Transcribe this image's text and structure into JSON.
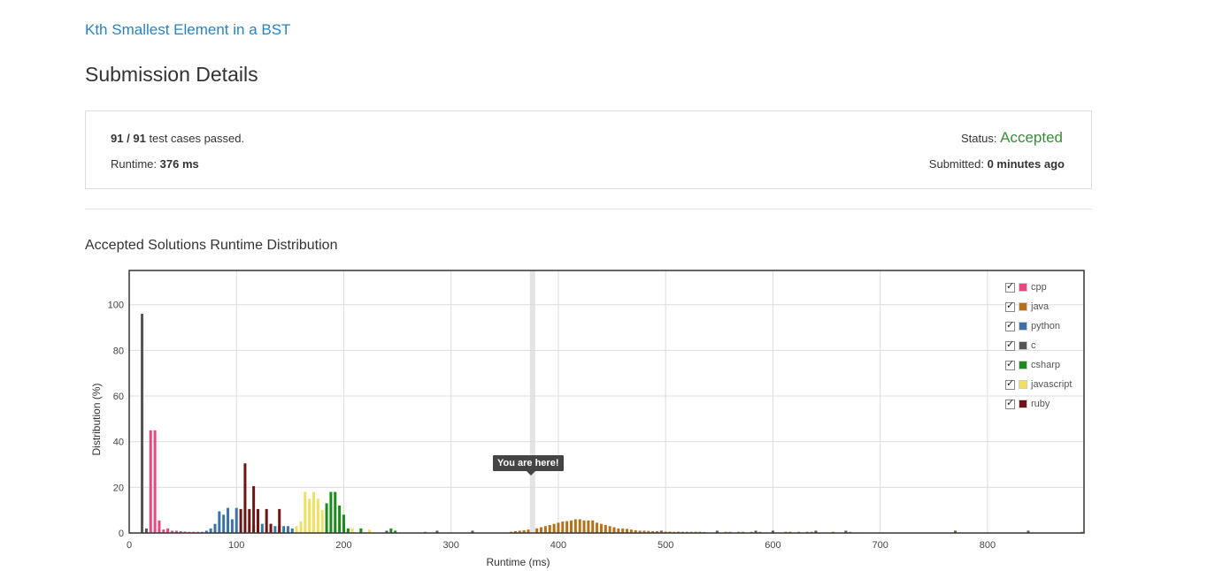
{
  "problem_link": "Kth Smallest Element in a BST",
  "page_title": "Submission Details",
  "details": {
    "passed": "91",
    "slash": "/",
    "total": "91",
    "passed_suffix": "test cases passed.",
    "runtime_label": "Runtime:",
    "runtime_value": "376 ms",
    "status_label": "Status:",
    "status_value": "Accepted",
    "submitted_label": "Submitted:",
    "submitted_value": "0 minutes ago"
  },
  "distribution_title": "Accepted Solutions Runtime Distribution",
  "tooltip": "You are here!",
  "legend": [
    {
      "name": "cpp",
      "color": "#e8487e"
    },
    {
      "name": "java",
      "color": "#b3711a"
    },
    {
      "name": "python",
      "color": "#3b73a6"
    },
    {
      "name": "c",
      "color": "#555555"
    },
    {
      "name": "csharp",
      "color": "#1a8a1a"
    },
    {
      "name": "javascript",
      "color": "#f0e060"
    },
    {
      "name": "ruby",
      "color": "#6e1414"
    }
  ],
  "chart_data": {
    "type": "bar",
    "xlabel": "Runtime (ms)",
    "ylabel": "Distribution (%)",
    "xlim": [
      0,
      890
    ],
    "ylim": [
      0,
      115
    ],
    "xticks": [
      0,
      100,
      200,
      300,
      400,
      500,
      600,
      700,
      800
    ],
    "yticks": [
      0,
      20,
      40,
      60,
      80,
      100
    ],
    "marker_x": 376,
    "series": [
      {
        "name": "c",
        "points": [
          [
            12,
            96
          ],
          [
            16,
            2
          ],
          [
            140,
            3
          ],
          [
            240,
            1
          ],
          [
            287,
            1
          ],
          [
            320,
            1
          ],
          [
            496,
            1
          ],
          [
            548,
            1
          ],
          [
            584,
            1
          ],
          [
            600,
            1
          ],
          [
            640,
            1
          ],
          [
            668,
            1
          ],
          [
            770,
            1
          ],
          [
            838,
            1
          ]
        ]
      },
      {
        "name": "cpp",
        "points": [
          [
            20,
            45
          ],
          [
            24,
            45
          ],
          [
            28,
            5.5
          ],
          [
            32,
            1.5
          ],
          [
            36,
            2
          ],
          [
            40,
            1
          ],
          [
            44,
            1
          ],
          [
            48,
            0.8
          ],
          [
            52,
            0.6
          ],
          [
            56,
            0.5
          ],
          [
            60,
            0.5
          ],
          [
            64,
            0.5
          ],
          [
            68,
            0.5
          ],
          [
            276,
            0.5
          ]
        ]
      },
      {
        "name": "python",
        "points": [
          [
            72,
            1
          ],
          [
            76,
            2
          ],
          [
            80,
            4
          ],
          [
            84,
            9.5
          ],
          [
            88,
            8
          ],
          [
            92,
            11
          ],
          [
            96,
            6
          ],
          [
            100,
            11
          ],
          [
            116,
            3.5
          ],
          [
            124,
            4
          ],
          [
            132,
            4
          ],
          [
            136,
            3
          ],
          [
            144,
            3
          ],
          [
            148,
            3
          ],
          [
            152,
            2
          ],
          [
            504,
            0.5
          ],
          [
            512,
            0.5
          ],
          [
            532,
            0.5
          ]
        ]
      },
      {
        "name": "ruby",
        "points": [
          [
            104,
            10.5
          ],
          [
            108,
            30.5
          ],
          [
            112,
            10.5
          ],
          [
            116,
            20.5
          ],
          [
            120,
            10.5
          ],
          [
            128,
            10.5
          ],
          [
            132,
            4
          ],
          [
            140,
            10.5
          ]
        ]
      },
      {
        "name": "javascript",
        "points": [
          [
            156,
            3
          ],
          [
            160,
            5
          ],
          [
            164,
            18
          ],
          [
            168,
            15
          ],
          [
            172,
            18
          ],
          [
            176,
            15
          ],
          [
            180,
            10
          ],
          [
            192,
            5
          ],
          [
            200,
            7
          ],
          [
            204,
            2
          ],
          [
            208,
            2
          ],
          [
            216,
            2
          ],
          [
            224,
            1.5
          ]
        ]
      },
      {
        "name": "csharp",
        "points": [
          [
            184,
            13
          ],
          [
            188,
            18
          ],
          [
            192,
            18
          ],
          [
            196,
            12
          ],
          [
            200,
            8
          ],
          [
            204,
            2
          ],
          [
            216,
            2
          ],
          [
            244,
            2
          ],
          [
            248,
            1
          ]
        ]
      },
      {
        "name": "java",
        "points": [
          [
            356,
            0.5
          ],
          [
            360,
            0.8
          ],
          [
            364,
            1
          ],
          [
            368,
            1.2
          ],
          [
            372,
            1.5
          ],
          [
            380,
            2
          ],
          [
            384,
            2.5
          ],
          [
            388,
            3
          ],
          [
            392,
            3.5
          ],
          [
            396,
            4
          ],
          [
            400,
            4.5
          ],
          [
            404,
            5
          ],
          [
            408,
            5.2
          ],
          [
            412,
            5.5
          ],
          [
            416,
            6
          ],
          [
            420,
            6
          ],
          [
            424,
            5.5
          ],
          [
            428,
            5.5
          ],
          [
            432,
            5.5
          ],
          [
            436,
            4.5
          ],
          [
            440,
            4
          ],
          [
            444,
            3.5
          ],
          [
            448,
            3
          ],
          [
            452,
            2.5
          ],
          [
            456,
            2
          ],
          [
            460,
            2
          ],
          [
            464,
            1.8
          ],
          [
            468,
            1.5
          ],
          [
            472,
            1.2
          ],
          [
            476,
            1
          ],
          [
            480,
            1
          ],
          [
            484,
            0.9
          ],
          [
            488,
            0.8
          ],
          [
            492,
            0.8
          ],
          [
            496,
            0.7
          ],
          [
            500,
            0.6
          ],
          [
            504,
            0.6
          ],
          [
            508,
            0.5
          ],
          [
            512,
            0.5
          ],
          [
            516,
            0.5
          ],
          [
            520,
            0.5
          ],
          [
            524,
            0.5
          ],
          [
            528,
            0.5
          ],
          [
            532,
            0.4
          ],
          [
            536,
            0.4
          ],
          [
            556,
            0.5
          ],
          [
            560,
            0.5
          ],
          [
            568,
            0.5
          ],
          [
            572,
            0.5
          ],
          [
            580,
            0.5
          ],
          [
            588,
            0.5
          ],
          [
            612,
            0.5
          ],
          [
            616,
            0.5
          ],
          [
            624,
            0.5
          ],
          [
            632,
            0.5
          ],
          [
            636,
            0.5
          ],
          [
            656,
            0.5
          ],
          [
            672,
            0.5
          ],
          [
            770,
            0.5
          ],
          [
            838,
            0.5
          ],
          [
            888,
            0.5
          ]
        ]
      }
    ]
  }
}
